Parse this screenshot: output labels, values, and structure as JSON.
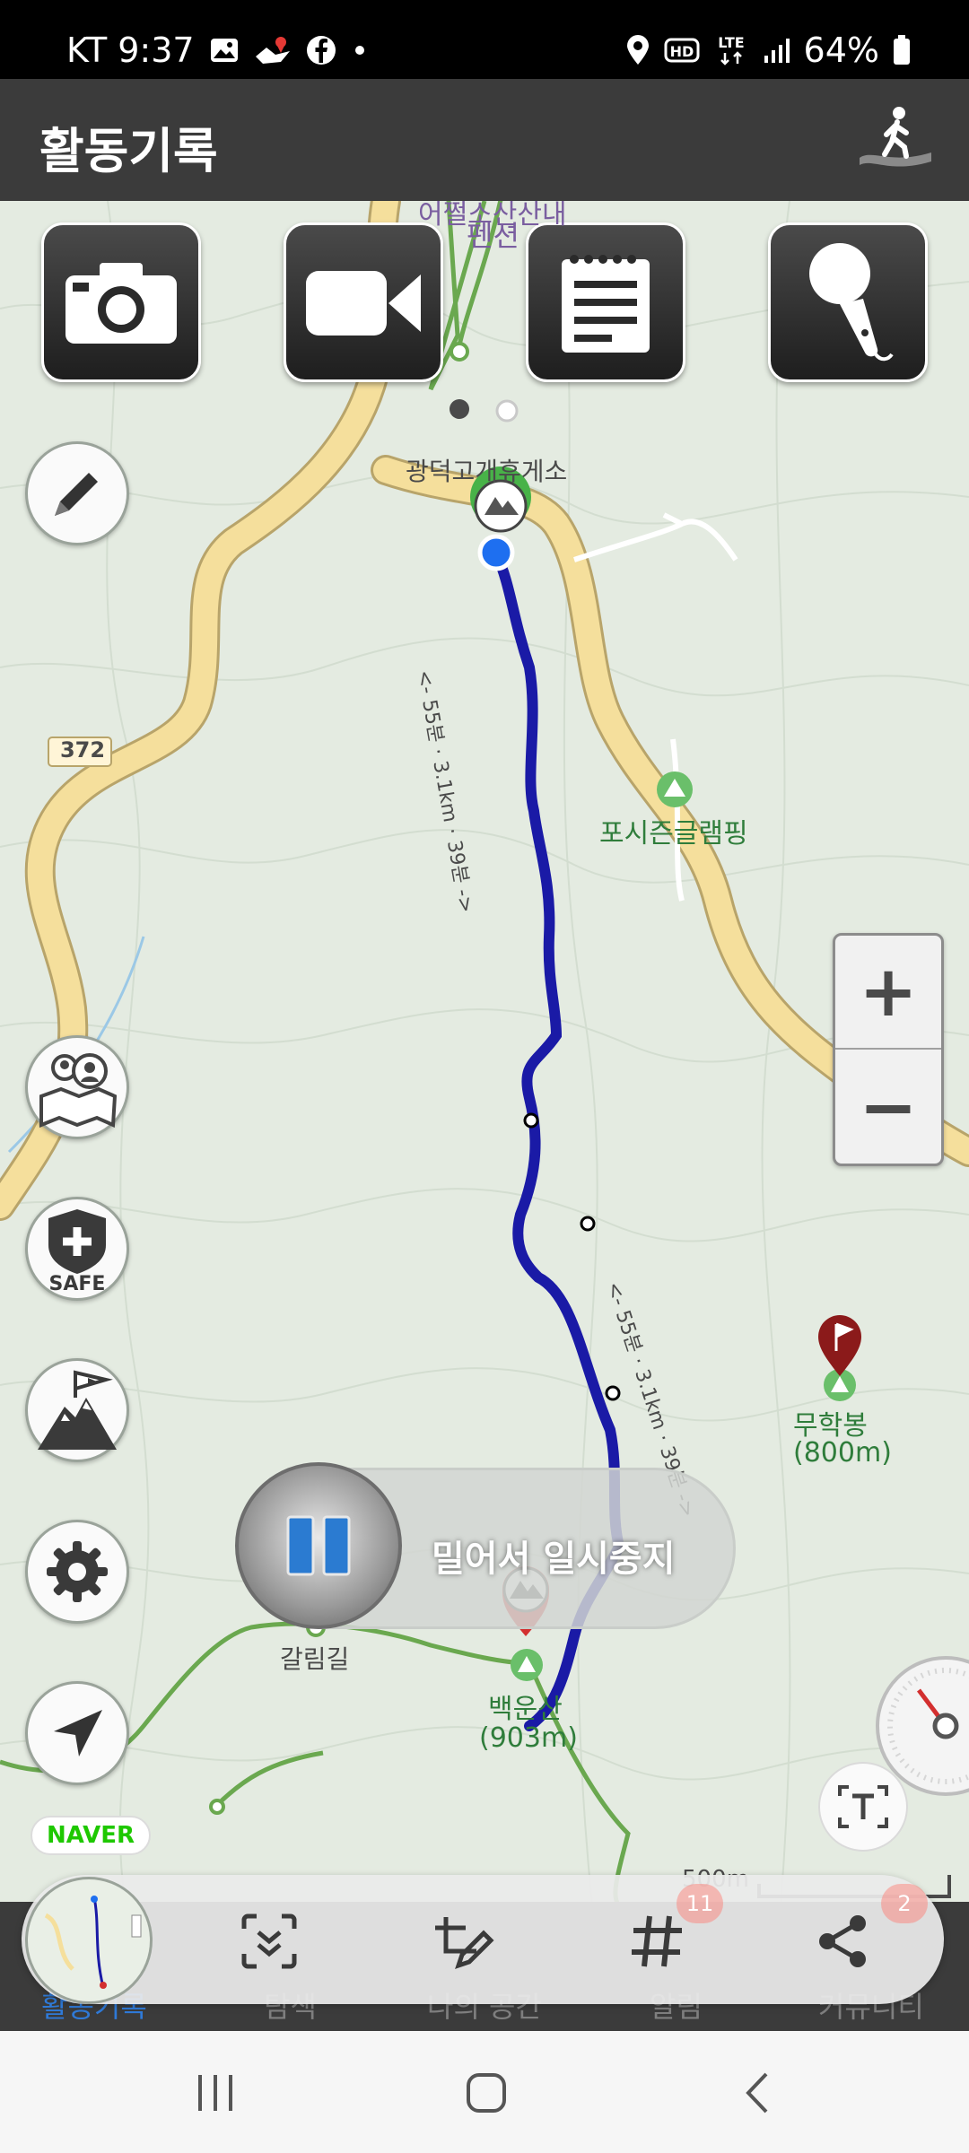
{
  "status_bar": {
    "carrier_time": "KT 9:37",
    "network": "LTE",
    "battery": "64%",
    "icons": [
      "gallery-icon",
      "map-pin-app-icon",
      "facebook-icon",
      "dot-icon",
      "location-icon",
      "hd-icon",
      "lte-icon",
      "signal-icon",
      "battery-icon"
    ]
  },
  "app_bar": {
    "title": "활동기록",
    "action_icon": "hiker-icon"
  },
  "toolbar": {
    "buttons": [
      "camera-icon",
      "video-camera-icon",
      "notepad-icon",
      "microphone-icon"
    ]
  },
  "side_buttons": [
    "pencil-icon",
    "group-map-icon",
    "safe-shield-icon",
    "summit-flag-icon",
    "gear-icon",
    "navigate-arrow-icon"
  ],
  "side_labels": {
    "safe": "SAFE"
  },
  "map": {
    "road_number": "372",
    "place_top": "펜션",
    "place_top_cut": "어쩔소산산내",
    "rest_area": "광덕고개휴게소",
    "camping": "포시즌글램핑",
    "peak_east": "무학봉",
    "peak_east_alt": "(800m)",
    "peak_south": "백운산",
    "peak_south_alt": "(903m)",
    "trail_label": "갈림길",
    "segment_label_1": "<- 55분 · 3.1km · 39분 ->",
    "segment_label_2": "<- 55분 · 3.1km · 39분 ->",
    "scale": "500m",
    "provider": "NAVER",
    "zoom_in": "+",
    "zoom_out": "−"
  },
  "pause_control": {
    "label": "밀어서 일시중지"
  },
  "bottom_nav": {
    "labels": [
      "활동기록",
      "탐색",
      "나의 공간",
      "알림",
      "커뮤니티"
    ],
    "icons": [
      "mini-map-icon",
      "capture-icon",
      "edit-route-icon",
      "hashtag-icon",
      "share-icon"
    ],
    "badges": [
      "11",
      "2"
    ]
  },
  "system_nav": [
    "recent-apps-icon",
    "home-icon",
    "back-icon"
  ],
  "colors": {
    "track": "#1a1aa6",
    "road": "#f5df9c",
    "trail": "#6aa84f",
    "app_bar": "#3b3b3b",
    "accent": "#2f7ad8"
  }
}
